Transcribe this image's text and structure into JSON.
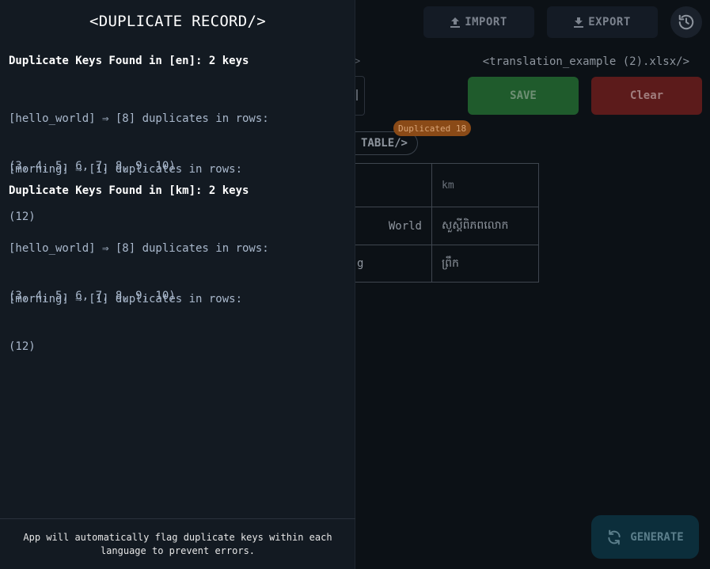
{
  "toolbar": {
    "import_label": "IMPORT",
    "export_label": "EXPORT",
    "save_label": "SAVE",
    "clear_label": "Clear",
    "generate_label": "GENERATE",
    "history_icon": "history-icon"
  },
  "file": {
    "name": "<translation_example (2).xlsx/>",
    "arrow_fragment": ">"
  },
  "tabs": {
    "table_label": "TABLE/>",
    "duplicated_badge": "Duplicated 18"
  },
  "table": {
    "header_km": "km",
    "rows": [
      {
        "en": "World",
        "km": "សួស្តីពិភពលោក"
      },
      {
        "en": "g",
        "km": "ព្រឹក"
      }
    ]
  },
  "drawer": {
    "title": "<DUPLICATE RECORD/>",
    "sections": [
      {
        "heading": "Duplicate Keys Found in [en]: 2 keys",
        "entries": [
          {
            "line1": "[hello_world] ⇒ [8] duplicates in rows:",
            "line2": "(3, 4, 5, 6, 7, 8, 9, 10)"
          },
          {
            "line1": "[morning] ⇒ [1] duplicates in rows:",
            "line2": "(12)"
          }
        ]
      },
      {
        "heading": "Duplicate Keys Found in [km]: 2 keys",
        "entries": [
          {
            "line1": "[hello_world] ⇒ [8] duplicates in rows:",
            "line2": "(3, 4, 5, 6, 7, 8, 9, 10)"
          },
          {
            "line1": "[morning] ⇒ [1] duplicates in rows:",
            "line2": "(12)"
          }
        ]
      }
    ],
    "footer": "App will automatically flag duplicate keys within each language to prevent errors."
  },
  "colors": {
    "drawer_bg": "#131a22",
    "save_bg": "#1f5b2c",
    "clear_bg": "#5c1b1b",
    "badge_bg": "#8a4a17",
    "generate_bg": "#0c2e3b"
  }
}
